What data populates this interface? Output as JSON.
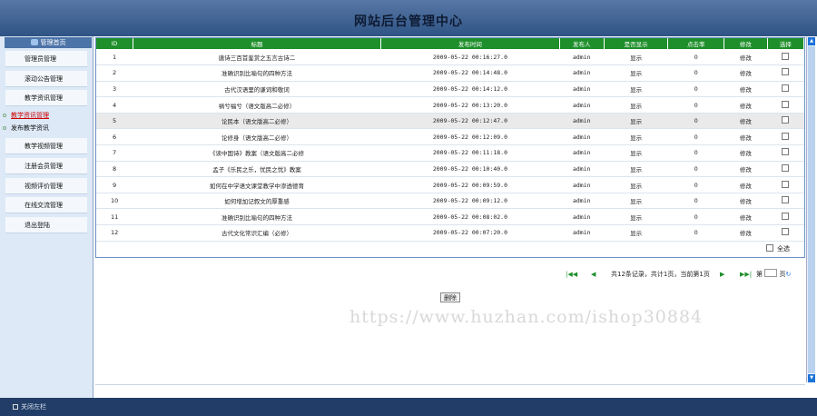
{
  "header": {
    "title": "网站后台管理中心"
  },
  "sidebar": {
    "home_label": "管理首页",
    "items": [
      {
        "label": "管理员管理"
      },
      {
        "label": "滚动公告管理"
      },
      {
        "label": "教学资讯管理"
      },
      {
        "label": "教学视频管理"
      },
      {
        "label": "注册会员管理"
      },
      {
        "label": "视频评价管理"
      },
      {
        "label": "在线交流管理"
      },
      {
        "label": "退出登陆"
      }
    ],
    "subitems": [
      {
        "label": "教学资讯管理",
        "active": true
      },
      {
        "label": "发布教学资讯",
        "active": false
      }
    ]
  },
  "table": {
    "columns": [
      "ID",
      "标题",
      "发布时间",
      "发布人",
      "是否显示",
      "点击率",
      "修改",
      "选择"
    ],
    "rows": [
      {
        "id": "1",
        "title": "唐诗三百首鉴赏之五言古诗二",
        "time": "2009-05-22 00:16:27.0",
        "author": "admin",
        "show": "显示",
        "clicks": "0",
        "edit": "修改"
      },
      {
        "id": "2",
        "title": "准确识别比喻句的四种方法",
        "time": "2009-05-22 00:14:48.0",
        "author": "admin",
        "show": "显示",
        "clicks": "0",
        "edit": "修改"
      },
      {
        "id": "3",
        "title": "古代汉语里的谦词和敬词",
        "time": "2009-05-22 00:14:12.0",
        "author": "admin",
        "show": "显示",
        "clicks": "0",
        "edit": "修改"
      },
      {
        "id": "4",
        "title": "祸兮福兮（语文版高二必修）",
        "time": "2009-05-22 00:13:20.0",
        "author": "admin",
        "show": "显示",
        "clicks": "0",
        "edit": "修改"
      },
      {
        "id": "5",
        "title": "论民本（语文版高二必修）",
        "time": "2009-05-22 00:12:47.0",
        "author": "admin",
        "show": "显示",
        "clicks": "0",
        "edit": "修改"
      },
      {
        "id": "6",
        "title": "论修身（语文版高二必修）",
        "time": "2009-05-22 00:12:09.0",
        "author": "admin",
        "show": "显示",
        "clicks": "0",
        "edit": "修改"
      },
      {
        "id": "7",
        "title": "《读中国诗》教案（语文版高二必修",
        "time": "2009-05-22 00:11:18.0",
        "author": "admin",
        "show": "显示",
        "clicks": "0",
        "edit": "修改"
      },
      {
        "id": "8",
        "title": "孟子《乐民之乐，忧民之忧》教案",
        "time": "2009-05-22 00:10:40.0",
        "author": "admin",
        "show": "显示",
        "clicks": "0",
        "edit": "修改"
      },
      {
        "id": "9",
        "title": "如何在中学语文课堂教学中渗透德育",
        "time": "2009-05-22 00:09:59.0",
        "author": "admin",
        "show": "显示",
        "clicks": "0",
        "edit": "修改"
      },
      {
        "id": "10",
        "title": "如何增加记叙文的厚重感",
        "time": "2009-05-22 00:09:12.0",
        "author": "admin",
        "show": "显示",
        "clicks": "0",
        "edit": "修改"
      },
      {
        "id": "11",
        "title": "准确识别比喻句的四种方法",
        "time": "2009-05-22 00:08:02.0",
        "author": "admin",
        "show": "显示",
        "clicks": "0",
        "edit": "修改"
      },
      {
        "id": "12",
        "title": "古代文化常识汇编（必修）",
        "time": "2009-05-22 00:07:20.0",
        "author": "admin",
        "show": "显示",
        "clicks": "0",
        "edit": "修改"
      }
    ],
    "highlighted_row": "5",
    "select_all_label": "全选"
  },
  "pager": {
    "info": "共12条记录，共计1页，当前第1页",
    "jump_prefix": "第",
    "jump_suffix": "页",
    "icons": [
      "first-page-icon",
      "prev-page-icon",
      "next-page-icon",
      "last-page-icon",
      "go-icon"
    ]
  },
  "actions": {
    "delete_label": "删除"
  },
  "watermark": "https://www.huzhan.com/ishop30884",
  "footer": {
    "close_sidebar_label": "关闭左栏"
  },
  "colors": {
    "header": "#2e5384",
    "table_header": "#1e8f2b",
    "footer": "#223e68",
    "sidebar": "#dde9f6"
  }
}
